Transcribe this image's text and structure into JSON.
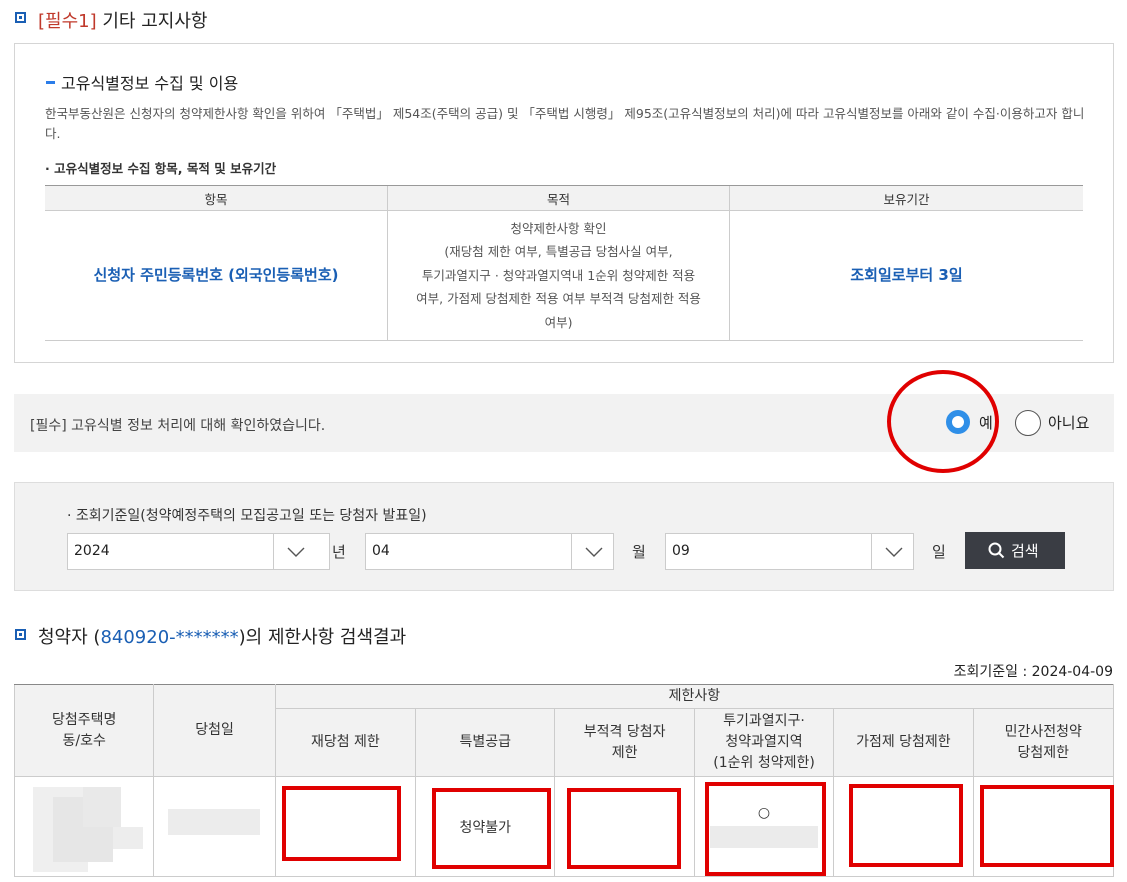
{
  "section1": {
    "required_tag": "[필수1]",
    "title": "기타 고지사항"
  },
  "notice": {
    "subtitle": "고유식별정보 수집 및 이용",
    "description": "한국부동산원은 신청자의 청약제한사항 확인을 위하여 「주택법」 제54조(주택의 공급) 및 「주택법 시행령」 제95조(고유식별정보의 처리)에 따라 고유식별정보를 아래와 같이 수집·이용하고자 합니다.",
    "bullet": "· 고유식별정보 수집 항목, 목적 및 보유기간",
    "table": {
      "headers": [
        "항목",
        "목적",
        "보유기간"
      ],
      "item": "신청자 주민등록번호 (외국인등록번호)",
      "purpose_lines": [
        "청약제한사항 확인",
        "(재당첨 제한 여부, 특별공급 당첨사실 여부,",
        "투기과열지구 · 청약과열지역내 1순위 청약제한 적용",
        "여부, 가점제 당첨제한 적용 여부 부적격 당첨제한 적용",
        "여부)"
      ],
      "retention": "조회일로부터 3일"
    }
  },
  "confirm": {
    "required": "[필수]",
    "text": "고유식별 정보 처리에 대해 확인하였습니다.",
    "yes_label": "예",
    "no_label": "아니요",
    "selected": "예"
  },
  "search": {
    "label": "· 조회기준일(청약예정주택의 모집공고일 또는 당첨자 발표일)",
    "year": "2024",
    "year_unit": "년",
    "month": "04",
    "month_unit": "월",
    "day": "09",
    "day_unit": "일",
    "button": "검색"
  },
  "result": {
    "title_prefix": "청약자 (",
    "masked_id": "840920-*******",
    "title_suffix": ")의 제한사항 검색결과",
    "ref_date": "조회기준일 : 2024-04-09",
    "headers": {
      "house": [
        "당첨주택명",
        "동/호수"
      ],
      "win_date": "당첨일",
      "restrictions": "제한사항",
      "cols": [
        [
          "재당첨 제한"
        ],
        [
          "특별공급"
        ],
        [
          "부적격 당첨자",
          "제한"
        ],
        [
          "투기과열지구·",
          "청약과열지역",
          "(1순위 청약제한)"
        ],
        [
          "가점제 당첨제한"
        ],
        [
          "민간사전청약",
          "당첨제한"
        ]
      ]
    },
    "row": {
      "special_supply": "청약불가",
      "overheated_mark": "○"
    }
  },
  "colors": {
    "accent_blue": "#1a5fb4",
    "radio_blue": "#2f8fe8",
    "annotation_red": "#e00000",
    "button_dark": "#3a3d44"
  }
}
